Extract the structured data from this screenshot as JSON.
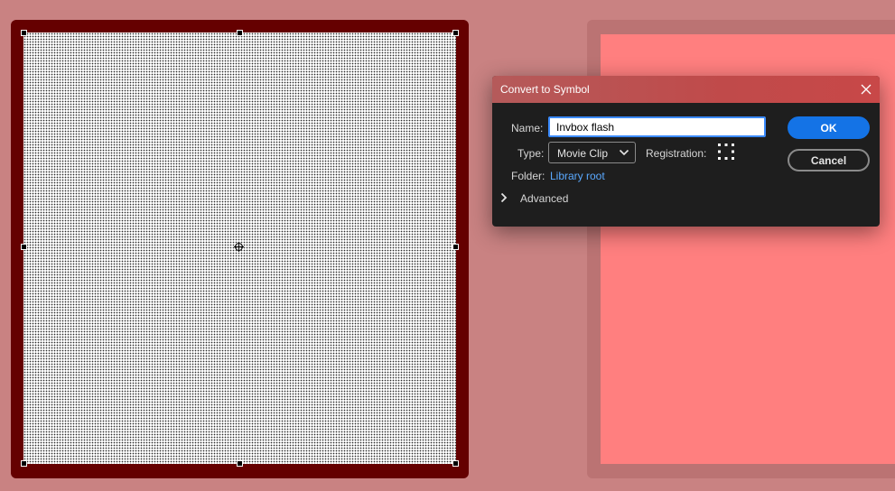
{
  "dialog": {
    "title": "Convert to Symbol",
    "name_label": "Name:",
    "name_value": "Invbox flash",
    "type_label": "Type:",
    "type_value": "Movie Clip",
    "registration_label": "Registration:",
    "folder_label": "Folder:",
    "folder_value": "Library root",
    "advanced_label": "Advanced",
    "ok_label": "OK",
    "cancel_label": "Cancel"
  },
  "icons": {
    "close": "close-icon",
    "type_dropdown": "chevron-down-icon",
    "advanced_toggle": "chevron-right-icon",
    "registration": "registration-grid-icon",
    "registration_point": "crosshair-icon"
  },
  "colors": {
    "stage_background": "#c98282",
    "left_object_stroke": "#650000",
    "right_object_fill": "#ff7f7f",
    "right_object_stroke": "#bb7373",
    "dialog_background": "#1e1e1e",
    "titlebar": "#c04a4a",
    "ok_button": "#1473e6",
    "link": "#5aa9ff",
    "input_focus": "#3b8bff"
  }
}
